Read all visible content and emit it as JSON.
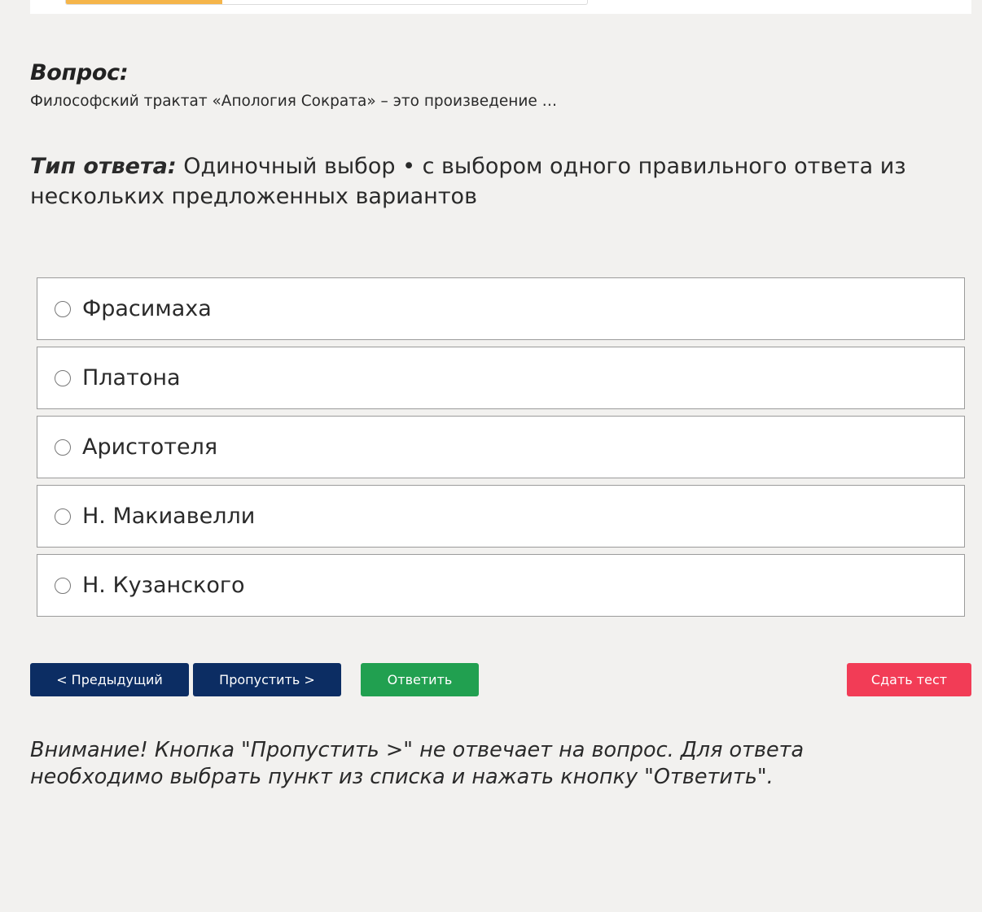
{
  "progress": {
    "fraction": 0.3
  },
  "question": {
    "heading": "Вопрос:",
    "text": "Философский трактат «Апология Сократа» – это произведение …"
  },
  "answer_type": {
    "label": "Тип ответа:",
    "value": "Одиночный выбор • с выбором одного правильного ответа из нескольких предложенных вариантов"
  },
  "options": [
    {
      "label": "Фрасимаха"
    },
    {
      "label": "Платона"
    },
    {
      "label": "Аристотеля"
    },
    {
      "label": "Н. Макиавелли"
    },
    {
      "label": "Н. Кузанского"
    }
  ],
  "buttons": {
    "prev": "< Предыдущий",
    "skip": "Пропустить >",
    "answer": "Ответить",
    "finish": "Сдать тест"
  },
  "warning": "Внимание! Кнопка \"Пропустить >\" не отвечает на вопрос. Для ответа необходимо выбрать пункт из списка и нажать кнопку \"Ответить\".",
  "colors": {
    "background": "#f2f1ef",
    "progress": "#f5b54a",
    "nav_button": "#0c2d63",
    "answer_button": "#21a050",
    "finish_button": "#f23c56"
  }
}
